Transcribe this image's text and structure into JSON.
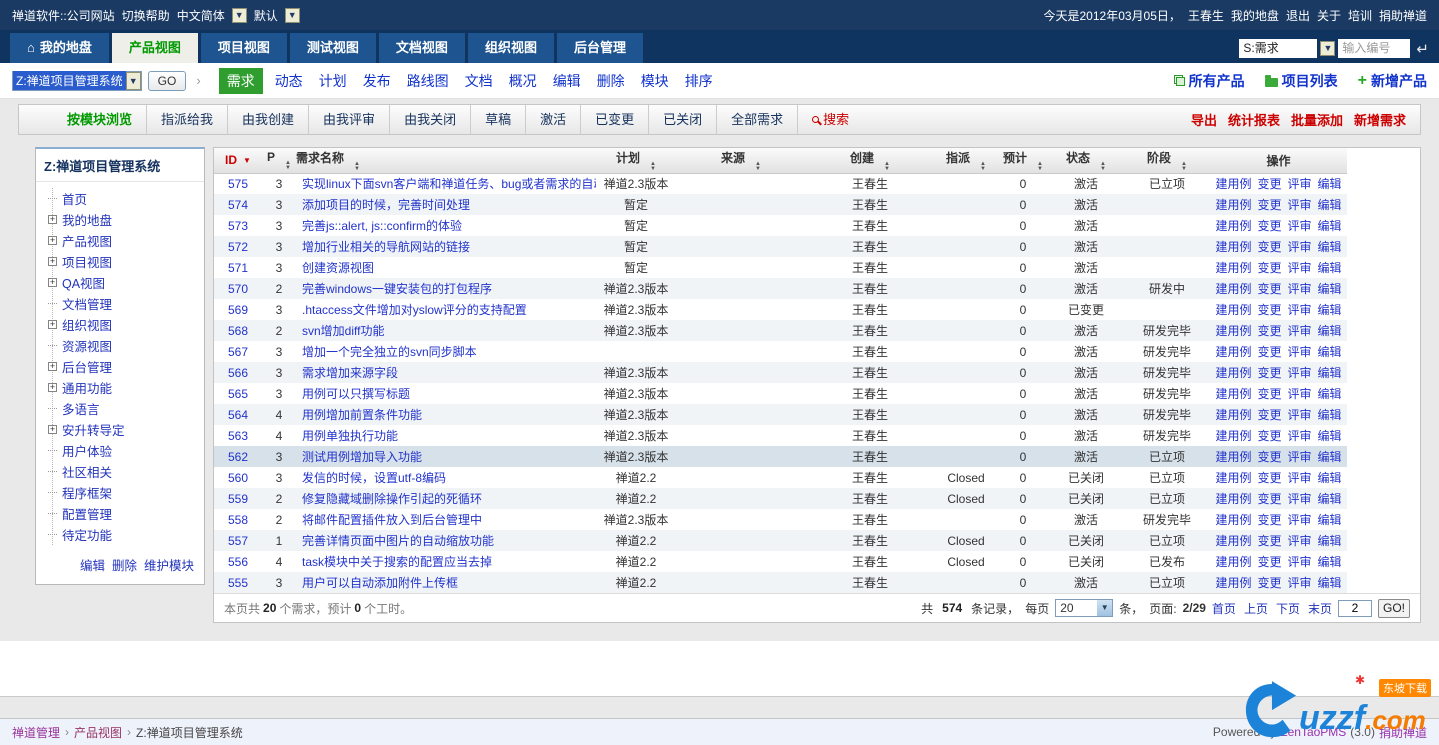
{
  "topbar": {
    "brand": "禅道软件::公司网站",
    "help": "切换帮助",
    "lang": "中文简体",
    "theme": "默认",
    "today": "今天是2012年03月05日，",
    "user": "王春生",
    "links": [
      "我的地盘",
      "退出",
      "关于",
      "培训",
      "捐助禅道"
    ]
  },
  "navbar": {
    "tabs": [
      {
        "label": "我的地盘",
        "icon": "home",
        "active": false
      },
      {
        "label": "产品视图",
        "active": true
      },
      {
        "label": "项目视图",
        "active": false
      },
      {
        "label": "测试视图",
        "active": false
      },
      {
        "label": "文档视图",
        "active": false
      },
      {
        "label": "组织视图",
        "active": false
      },
      {
        "label": "后台管理",
        "active": false
      }
    ],
    "search": {
      "select_value": "S:需求",
      "placeholder": "输入编号"
    }
  },
  "subnav": {
    "product_select": "Z:禅道项目管理系统",
    "go": "GO",
    "items": [
      {
        "label": "需求",
        "active": true
      },
      {
        "label": "动态"
      },
      {
        "label": "计划"
      },
      {
        "label": "发布"
      },
      {
        "label": "路线图"
      },
      {
        "label": "文档"
      },
      {
        "label": "概况"
      },
      {
        "label": "编辑"
      },
      {
        "label": "删除"
      },
      {
        "label": "模块"
      },
      {
        "label": "排序"
      }
    ],
    "right_links": [
      {
        "label": "所有产品",
        "icon": "copy-icon"
      },
      {
        "label": "项目列表",
        "icon": "folder-icon"
      },
      {
        "label": "新增产品",
        "icon": "plus-icon"
      }
    ]
  },
  "toolbar": {
    "items": [
      {
        "label": "按模块浏览",
        "style": "active"
      },
      {
        "label": "指派给我"
      },
      {
        "label": "由我创建"
      },
      {
        "label": "由我评审"
      },
      {
        "label": "由我关闭"
      },
      {
        "label": "草稿"
      },
      {
        "label": "激活"
      },
      {
        "label": "已变更"
      },
      {
        "label": "已关闭"
      },
      {
        "label": "全部需求"
      },
      {
        "label": "搜索",
        "style": "search"
      }
    ],
    "right_links": [
      "导出",
      "统计报表",
      "批量添加",
      "新增需求"
    ]
  },
  "sidebar": {
    "title": "Z:禅道项目管理系统",
    "items": [
      {
        "label": "首页",
        "expandable": false
      },
      {
        "label": "我的地盘",
        "expandable": true
      },
      {
        "label": "产品视图",
        "expandable": true
      },
      {
        "label": "项目视图",
        "expandable": true
      },
      {
        "label": "QA视图",
        "expandable": true
      },
      {
        "label": "文档管理",
        "expandable": false
      },
      {
        "label": "组织视图",
        "expandable": true
      },
      {
        "label": "资源视图",
        "expandable": false
      },
      {
        "label": "后台管理",
        "expandable": true
      },
      {
        "label": "通用功能",
        "expandable": true
      },
      {
        "label": "多语言",
        "expandable": false
      },
      {
        "label": "安升转导定",
        "expandable": true
      },
      {
        "label": "用户体验",
        "expandable": false
      },
      {
        "label": "社区相关",
        "expandable": false
      },
      {
        "label": "程序框架",
        "expandable": false
      },
      {
        "label": "配置管理",
        "expandable": false
      },
      {
        "label": "待定功能",
        "expandable": false
      }
    ],
    "footer_links": [
      "编辑",
      "删除",
      "维护模块"
    ]
  },
  "table": {
    "columns": [
      {
        "label": "ID",
        "sort": "desc"
      },
      {
        "label": "P",
        "sort": "both"
      },
      {
        "label": "需求名称",
        "sort": "both"
      },
      {
        "label": "计划",
        "sort": "both"
      },
      {
        "label": "来源",
        "sort": "both"
      },
      {
        "label": "创建",
        "sort": "both"
      },
      {
        "label": "指派",
        "sort": "both"
      },
      {
        "label": "预计",
        "sort": "both"
      },
      {
        "label": "状态",
        "sort": "both"
      },
      {
        "label": "阶段",
        "sort": "both"
      },
      {
        "label": "操作",
        "sort": "none"
      }
    ],
    "row_actions": [
      "建用例",
      "变更",
      "评审",
      "编辑"
    ],
    "rows": [
      {
        "id": "575",
        "p": "3",
        "name": "实现linux下面svn客户端和禅道任务、bug或者需求的自动绑定",
        "plan": "禅道2.3版本",
        "source": "",
        "created": "王春生",
        "assigned": "",
        "estimate": "0",
        "status": "激活",
        "stage": "已立项",
        "highlight": false
      },
      {
        "id": "574",
        "p": "3",
        "name": "添加项目的时候，完善时间处理",
        "plan": "暂定",
        "source": "",
        "created": "王春生",
        "assigned": "",
        "estimate": "0",
        "status": "激活",
        "stage": "",
        "highlight": false
      },
      {
        "id": "573",
        "p": "3",
        "name": "完善js::alert, js::confirm的体验",
        "plan": "暂定",
        "source": "",
        "created": "王春生",
        "assigned": "",
        "estimate": "0",
        "status": "激活",
        "stage": "",
        "highlight": false
      },
      {
        "id": "572",
        "p": "3",
        "name": "增加行业相关的导航网站的链接",
        "plan": "暂定",
        "source": "",
        "created": "王春生",
        "assigned": "",
        "estimate": "0",
        "status": "激活",
        "stage": "",
        "highlight": false
      },
      {
        "id": "571",
        "p": "3",
        "name": "创建资源视图",
        "plan": "暂定",
        "source": "",
        "created": "王春生",
        "assigned": "",
        "estimate": "0",
        "status": "激活",
        "stage": "",
        "highlight": false
      },
      {
        "id": "570",
        "p": "2",
        "name": "完善windows一键安装包的打包程序",
        "plan": "禅道2.3版本",
        "source": "",
        "created": "王春生",
        "assigned": "",
        "estimate": "0",
        "status": "激活",
        "stage": "研发中",
        "highlight": false
      },
      {
        "id": "569",
        "p": "3",
        "name": ".htaccess文件增加对yslow评分的支持配置",
        "plan": "禅道2.3版本",
        "source": "",
        "created": "王春生",
        "assigned": "",
        "estimate": "0",
        "status": "已变更",
        "stage": "",
        "highlight": false
      },
      {
        "id": "568",
        "p": "2",
        "name": "svn增加diff功能",
        "plan": "禅道2.3版本",
        "source": "",
        "created": "王春生",
        "assigned": "",
        "estimate": "0",
        "status": "激活",
        "stage": "研发完毕",
        "highlight": false
      },
      {
        "id": "567",
        "p": "3",
        "name": "增加一个完全独立的svn同步脚本",
        "plan": "",
        "source": "",
        "created": "王春生",
        "assigned": "",
        "estimate": "0",
        "status": "激活",
        "stage": "研发完毕",
        "highlight": false
      },
      {
        "id": "566",
        "p": "3",
        "name": "需求增加来源字段",
        "plan": "禅道2.3版本",
        "source": "",
        "created": "王春生",
        "assigned": "",
        "estimate": "0",
        "status": "激活",
        "stage": "研发完毕",
        "highlight": false
      },
      {
        "id": "565",
        "p": "3",
        "name": "用例可以只撰写标题",
        "plan": "禅道2.3版本",
        "source": "",
        "created": "王春生",
        "assigned": "",
        "estimate": "0",
        "status": "激活",
        "stage": "研发完毕",
        "highlight": false
      },
      {
        "id": "564",
        "p": "4",
        "name": "用例增加前置条件功能",
        "plan": "禅道2.3版本",
        "source": "",
        "created": "王春生",
        "assigned": "",
        "estimate": "0",
        "status": "激活",
        "stage": "研发完毕",
        "highlight": false
      },
      {
        "id": "563",
        "p": "4",
        "name": "用例单独执行功能",
        "plan": "禅道2.3版本",
        "source": "",
        "created": "王春生",
        "assigned": "",
        "estimate": "0",
        "status": "激活",
        "stage": "研发完毕",
        "highlight": false
      },
      {
        "id": "562",
        "p": "3",
        "name": "测试用例增加导入功能",
        "plan": "禅道2.3版本",
        "source": "",
        "created": "王春生",
        "assigned": "",
        "estimate": "0",
        "status": "激活",
        "stage": "已立项",
        "highlight": true
      },
      {
        "id": "560",
        "p": "3",
        "name": "发信的时候，设置utf-8编码",
        "plan": "禅道2.2",
        "source": "",
        "created": "王春生",
        "assigned": "Closed",
        "estimate": "0",
        "status": "已关闭",
        "stage": "已立项",
        "highlight": false
      },
      {
        "id": "559",
        "p": "2",
        "name": "修复隐藏域删除操作引起的死循环",
        "plan": "禅道2.2",
        "source": "",
        "created": "王春生",
        "assigned": "Closed",
        "estimate": "0",
        "status": "已关闭",
        "stage": "已立项",
        "highlight": false
      },
      {
        "id": "558",
        "p": "2",
        "name": "将邮件配置插件放入到后台管理中",
        "plan": "禅道2.3版本",
        "source": "",
        "created": "王春生",
        "assigned": "",
        "estimate": "0",
        "status": "激活",
        "stage": "研发完毕",
        "highlight": false
      },
      {
        "id": "557",
        "p": "1",
        "name": "完善详情页面中图片的自动缩放功能",
        "plan": "禅道2.2",
        "source": "",
        "created": "王春生",
        "assigned": "Closed",
        "estimate": "0",
        "status": "已关闭",
        "stage": "已立项",
        "highlight": false
      },
      {
        "id": "556",
        "p": "4",
        "name": "task模块中关于搜索的配置应当去掉",
        "plan": "禅道2.2",
        "source": "",
        "created": "王春生",
        "assigned": "Closed",
        "estimate": "0",
        "status": "已关闭",
        "stage": "已发布",
        "highlight": false
      },
      {
        "id": "555",
        "p": "3",
        "name": "用户可以自动添加附件上传框",
        "plan": "禅道2.2",
        "source": "",
        "created": "王春生",
        "assigned": "",
        "estimate": "0",
        "status": "激活",
        "stage": "已立项",
        "highlight": false
      }
    ],
    "summary": {
      "seg1": "本页共",
      "count": "20",
      "seg2": "个需求，预计",
      "hours": "0",
      "seg3": "个工时。"
    },
    "pagination": {
      "seg1": "共",
      "total": "574",
      "seg2": "条记录，",
      "seg3": "每页",
      "per_page": "20",
      "seg4": "条，",
      "seg5": "页面:",
      "current": "2/29",
      "links": [
        "首页",
        "上页",
        "下页",
        "末页"
      ],
      "input_value": "2",
      "go": "GO!"
    }
  },
  "footer": {
    "breadcrumb": [
      "禅道管理",
      "产品视图",
      "Z:禅道项目管理系统"
    ],
    "powered_prefix": "Powered by",
    "powered_link": "ZenTaoPMS",
    "powered_version": "(3.0)",
    "donate": "捐助禅道"
  },
  "watermark": {
    "name": "uzzf",
    "tld": ".com",
    "badge": "东坡下载"
  }
}
